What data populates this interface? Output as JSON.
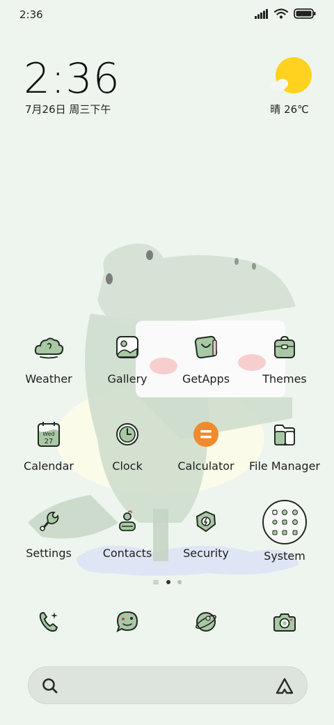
{
  "status_bar": {
    "time": "2:36",
    "icons": [
      "signal-icon",
      "wifi-icon",
      "battery-icon"
    ]
  },
  "clock_widget": {
    "time": "2:36",
    "date": "7月26日 周三下午"
  },
  "weather_widget": {
    "condition": "晴",
    "temperature": "26℃",
    "text": "晴 26℃",
    "icon": "sun-cloud-icon"
  },
  "apps": [
    {
      "label": "Weather",
      "icon": "cloud-icon"
    },
    {
      "label": "Gallery",
      "icon": "picture-icon"
    },
    {
      "label": "GetApps",
      "icon": "getapps-icon"
    },
    {
      "label": "Themes",
      "icon": "themes-bag-icon"
    },
    {
      "label": "Calendar",
      "icon": "calendar-icon",
      "icon_text_day": "Wed",
      "icon_text_date": "27"
    },
    {
      "label": "Clock",
      "icon": "clock-icon"
    },
    {
      "label": "Calculator",
      "icon": "calculator-icon"
    },
    {
      "label": "File Manager",
      "icon": "folder-icon"
    },
    {
      "label": "Settings",
      "icon": "settings-icon"
    },
    {
      "label": "Contacts",
      "icon": "contacts-icon"
    },
    {
      "label": "Security",
      "icon": "security-icon"
    },
    {
      "label": "System",
      "icon": "system-folder-icon"
    }
  ],
  "dock": [
    {
      "icon": "phone-icon"
    },
    {
      "icon": "messages-icon"
    },
    {
      "icon": "browser-icon"
    },
    {
      "icon": "camera-icon"
    }
  ],
  "pager": {
    "pages": 2,
    "active": 0
  },
  "search_bar": {
    "left_icon": "search-icon",
    "right_icon": "assistant-icon"
  },
  "colors": {
    "background": "#eef5ee",
    "icon_fill": "#a9c8a5",
    "icon_stroke": "#1e2a1e",
    "calculator_orange": "#f08a2c",
    "weather_sun": "#ffd21f"
  }
}
